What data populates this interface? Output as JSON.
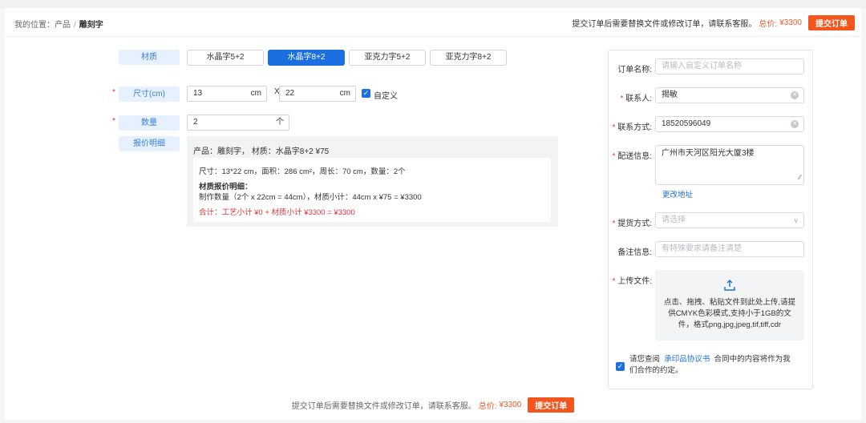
{
  "breadcrumb": {
    "prefix": "我的位置：",
    "product": "产品",
    "separator": "/",
    "current": "雕刻字"
  },
  "header": {
    "note": "提交订单后需要替换文件或修改订单，请联系客服。",
    "total_label": "总价:",
    "total_value": "¥3300",
    "submit_label": "提交订单"
  },
  "form": {
    "material_label": "材质",
    "materials": [
      "水晶字5+2",
      "水晶字8+2",
      "亚克力字5+2",
      "亚克力字8+2"
    ],
    "selected_material": "水晶字8+2",
    "size_label": "尺寸(cm)",
    "width": "13",
    "height": "22",
    "unit": "cm",
    "times": "X",
    "custom_label": "自定义",
    "custom_checked": true,
    "qty_label": "数量",
    "qty_value": "2",
    "qty_arrow": "个",
    "quote_label": "报价明细"
  },
  "quote": {
    "title": "产品：雕刻字， 材质：水晶字8+2 ¥75",
    "specs": "尺寸：13*22 cm，面积：286 cm²，周长：70 cm，数量：2个",
    "detail_heading": "材质报价明细：",
    "detail_line": "制作数量（2个 x 22cm = 44cm），材质小计：44cm x ¥75 = ¥3300",
    "total_line": "合计：工艺小计 ¥0 + 材质小计 ¥3300 = ¥3300"
  },
  "footer": {
    "note": "提交订单后需要替换文件或修改订单，请联系客服。",
    "total_label": "总价:",
    "total_value": "¥3300",
    "submit_label": "提交订单"
  },
  "order": {
    "name_label": "订单名称:",
    "name_placeholder": "请输入自定义订单名称",
    "contact_label": "联系人:",
    "contact_value": "揭敏",
    "phone_label": "联系方式:",
    "phone_value": "18520596049",
    "address_label": "配送信息:",
    "address_value": "广州市天河区阳光大厦3楼",
    "change_address": "更改地址",
    "delivery_label": "提货方式:",
    "delivery_placeholder": "请选择",
    "remark_label": "备注信息:",
    "remark_placeholder": "有特殊要求请备注清楚",
    "upload_label": "上传文件:",
    "upload_text": "点击、拖拽、粘贴文件到此处上传,请提供CMYK色彩模式,支持小于1GB的文件，格式png,jpg,jpeg,tif,tiff,cdr",
    "agree_prefix": "请您查阅",
    "agree_link": "承印品协议书",
    "agree_suffix": "合同中的内容将作为我们合作的约定。",
    "agree_checked": true
  },
  "colors": {
    "accent": "#1b6fe0",
    "brand_orange": "#f2561d",
    "required": "#e0343c",
    "label_bg": "#e7f1fd"
  },
  "icons": [
    "check-icon",
    "clear-icon",
    "chevron-down-icon",
    "upload-icon",
    "resize-handle-icon"
  ]
}
